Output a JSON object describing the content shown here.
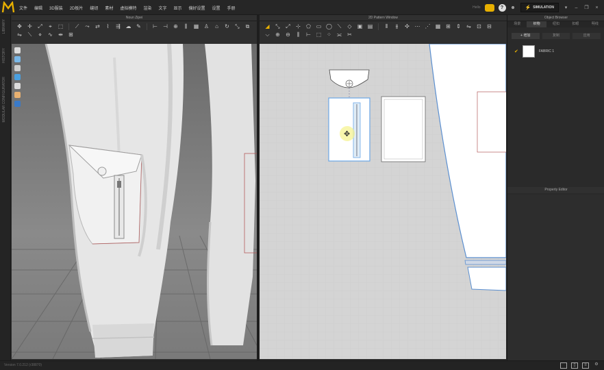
{
  "app": {
    "logo": "M"
  },
  "menu": [
    "文件",
    "编辑",
    "3D服装",
    "2D板片",
    "缝纫",
    "素材",
    "虚拟模特",
    "渲染",
    "文字",
    "显示",
    "偏好设置",
    "设置",
    "手册"
  ],
  "top_right": {
    "simulation_label": "SIMULATION",
    "user_text": "Hello",
    "help_glyph": "?"
  },
  "left_tabs": [
    "LIBRARY",
    "HISTORY",
    "MODULAR CONFIGURATOR"
  ],
  "view3d": {
    "title": "Noun Zipei"
  },
  "view2d": {
    "title": "2D Pattern Window"
  },
  "object_browser": {
    "title": "Object Browser",
    "tabs": [
      "场景",
      "织物",
      "纽扣",
      "扣眼",
      "明线"
    ],
    "active_tab": 1,
    "buttons": [
      "+ 增加",
      "复制",
      "应用"
    ],
    "fabric_item": "FABRIC 1"
  },
  "property_editor": {
    "title": "Property Editor"
  },
  "status": {
    "text": "Version 7.0.212 (r38870)"
  },
  "colors": {
    "accent": "#e8b000",
    "selection_blue": "#6aa6e6"
  },
  "icons": [
    "logo-icon",
    "camera-icon",
    "help-icon",
    "avatar-icon",
    "simulation-icon"
  ]
}
